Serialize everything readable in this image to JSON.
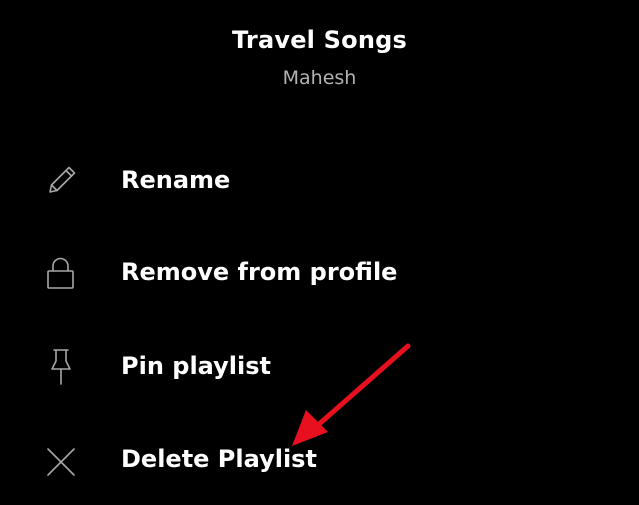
{
  "header": {
    "title": "Travel Songs",
    "owner": "Mahesh"
  },
  "menu": {
    "items": [
      {
        "label": "Rename",
        "icon": "pencil-icon"
      },
      {
        "label": "Remove from profile",
        "icon": "lock-icon"
      },
      {
        "label": "Pin playlist",
        "icon": "pin-icon"
      },
      {
        "label": "Delete Playlist",
        "icon": "close-icon"
      }
    ]
  },
  "colors": {
    "background": "#000000",
    "text": "#ffffff",
    "subtext": "#b3b3b3",
    "icon": "#a7a7a7",
    "annotation_arrow": "#e8101e"
  }
}
